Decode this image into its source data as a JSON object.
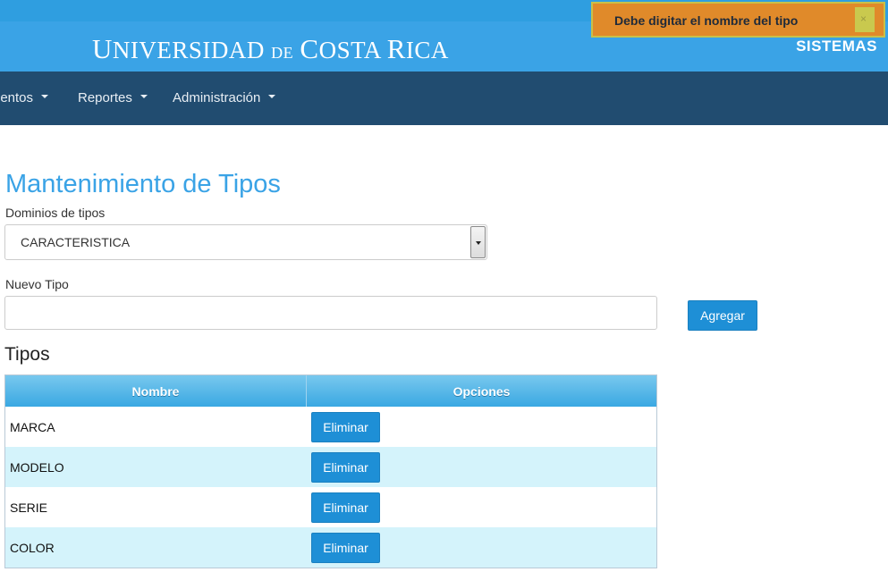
{
  "header": {
    "brand": "UNIVERSIDAD DE COSTA RICA",
    "brand_parts": {
      "u": "U",
      "niversidad": "NIVERSIDAD",
      "de": "DE",
      "c": "C",
      "osta": "OSTA",
      "r": "R",
      "ica": "ICA"
    },
    "section": "SISTEMAS"
  },
  "toast": {
    "message": "Debe digitar el nombre del tipo",
    "close_glyph": "×"
  },
  "nav": {
    "items": [
      {
        "label": "ientos"
      },
      {
        "label": "Reportes"
      },
      {
        "label": "Administración"
      }
    ]
  },
  "page": {
    "title": "Mantenimiento de Tipos",
    "domain_label": "Dominios de tipos",
    "domain_selected": "CARACTERISTICA",
    "new_type_label": "Nuevo Tipo",
    "new_type_value": "",
    "add_button": "Agregar",
    "list_title": "Tipos"
  },
  "table": {
    "headers": [
      "Nombre",
      "Opciones"
    ],
    "rows": [
      {
        "name": "MARCA",
        "action": "Eliminar"
      },
      {
        "name": "MODELO",
        "action": "Eliminar"
      },
      {
        "name": "SERIE",
        "action": "Eliminar"
      },
      {
        "name": "COLOR",
        "action": "Eliminar"
      }
    ]
  },
  "colors": {
    "brand_blue": "#3aa3e6",
    "nav_dark": "#214c70",
    "toast_orange": "#e08a2a",
    "button_blue": "#1e8fd6",
    "row_alt": "#d4f3fb"
  },
  "icons": {
    "nav_caret": "caret-down-icon",
    "select_arrow": "select-arrow-icon",
    "toast_close": "close-icon"
  }
}
